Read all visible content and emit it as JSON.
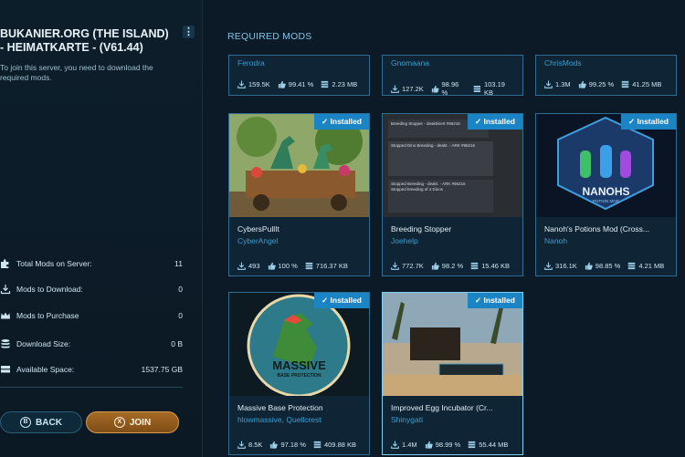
{
  "server": {
    "title": "BUKANIER.ORG (THE ISLAND) - HEIMATKARTE - (V61.44)",
    "menu_icon": "⋮",
    "description": "To join this server, you need to download the required mods."
  },
  "stats": [
    {
      "label": "Total Mods on Server:",
      "value": "11",
      "icon": "puzzle-icon"
    },
    {
      "label": "Mods to Download:",
      "value": "0",
      "icon": "download-icon"
    },
    {
      "label": "Mods to Purchase",
      "value": "0",
      "icon": "crown-icon"
    },
    {
      "label": "Download Size:",
      "value": "0 B",
      "icon": "database-icon"
    },
    {
      "label": "Available Space:",
      "value": "1537.75 GB",
      "icon": "drive-icon"
    }
  ],
  "buttons": {
    "back_key": "B",
    "back_label": "BACK",
    "join_key": "X",
    "join_label": "JOIN"
  },
  "section_title": "REQUIRED MODS",
  "top_row": [
    {
      "author": "Ferodra",
      "downloads": "159.5K",
      "rating": "99.41 %",
      "size": "2.23 MB"
    },
    {
      "author": "Gnomaana",
      "downloads": "127.2K",
      "rating": "98.96 %",
      "size": "103.19 KB"
    },
    {
      "author": "ChrisMods",
      "downloads": "1.3M",
      "rating": "99.25 %",
      "size": "41.25 MB"
    }
  ],
  "mods": [
    {
      "name": "CybersPullIt",
      "author": "CyberAngel",
      "downloads": "493",
      "rating": "100 %",
      "size": "716.37 KB",
      "badge": "Installed"
    },
    {
      "name": "Breeding Stopper",
      "author": "Joehelp",
      "downloads": "772.7K",
      "rating": "98.2 %",
      "size": "15.46 KB",
      "badge": "Installed",
      "thumb_lines": [
        "Breeding Stopper - deaktiviert #96216",
        "Stopped Dino Breeding - deakt. - ARK #96216",
        "Stopped breeding of 4 Dinos",
        "Stopped Breeding - deakt. - ARK #96216"
      ]
    },
    {
      "name": "Nanoh's Potions Mod (Cross...",
      "author": "Nanoh",
      "downloads": "316.1K",
      "rating": "98.85 %",
      "size": "4.21 MB",
      "badge": "Installed",
      "thumb_text": "NANOHS",
      "thumb_sub": "POTION MOD"
    },
    {
      "name": "Massive Base Protection",
      "author": "hlowmassive, Quellcrest",
      "downloads": "8.5K",
      "rating": "97.18 %",
      "size": "409.88 KB",
      "badge": "Installed",
      "thumb_text": "MASSIVE",
      "thumb_sub": "BASE PROTECTION"
    },
    {
      "name": "Improved Egg Incubator (Cr...",
      "author": "Shinygati",
      "downloads": "1.4M",
      "rating": "98.99 %",
      "size": "55.44 MB",
      "badge": "Installed"
    }
  ],
  "colors": {
    "accent": "#1b84c4",
    "join": "#a56a25",
    "link": "#3a9ed0"
  }
}
